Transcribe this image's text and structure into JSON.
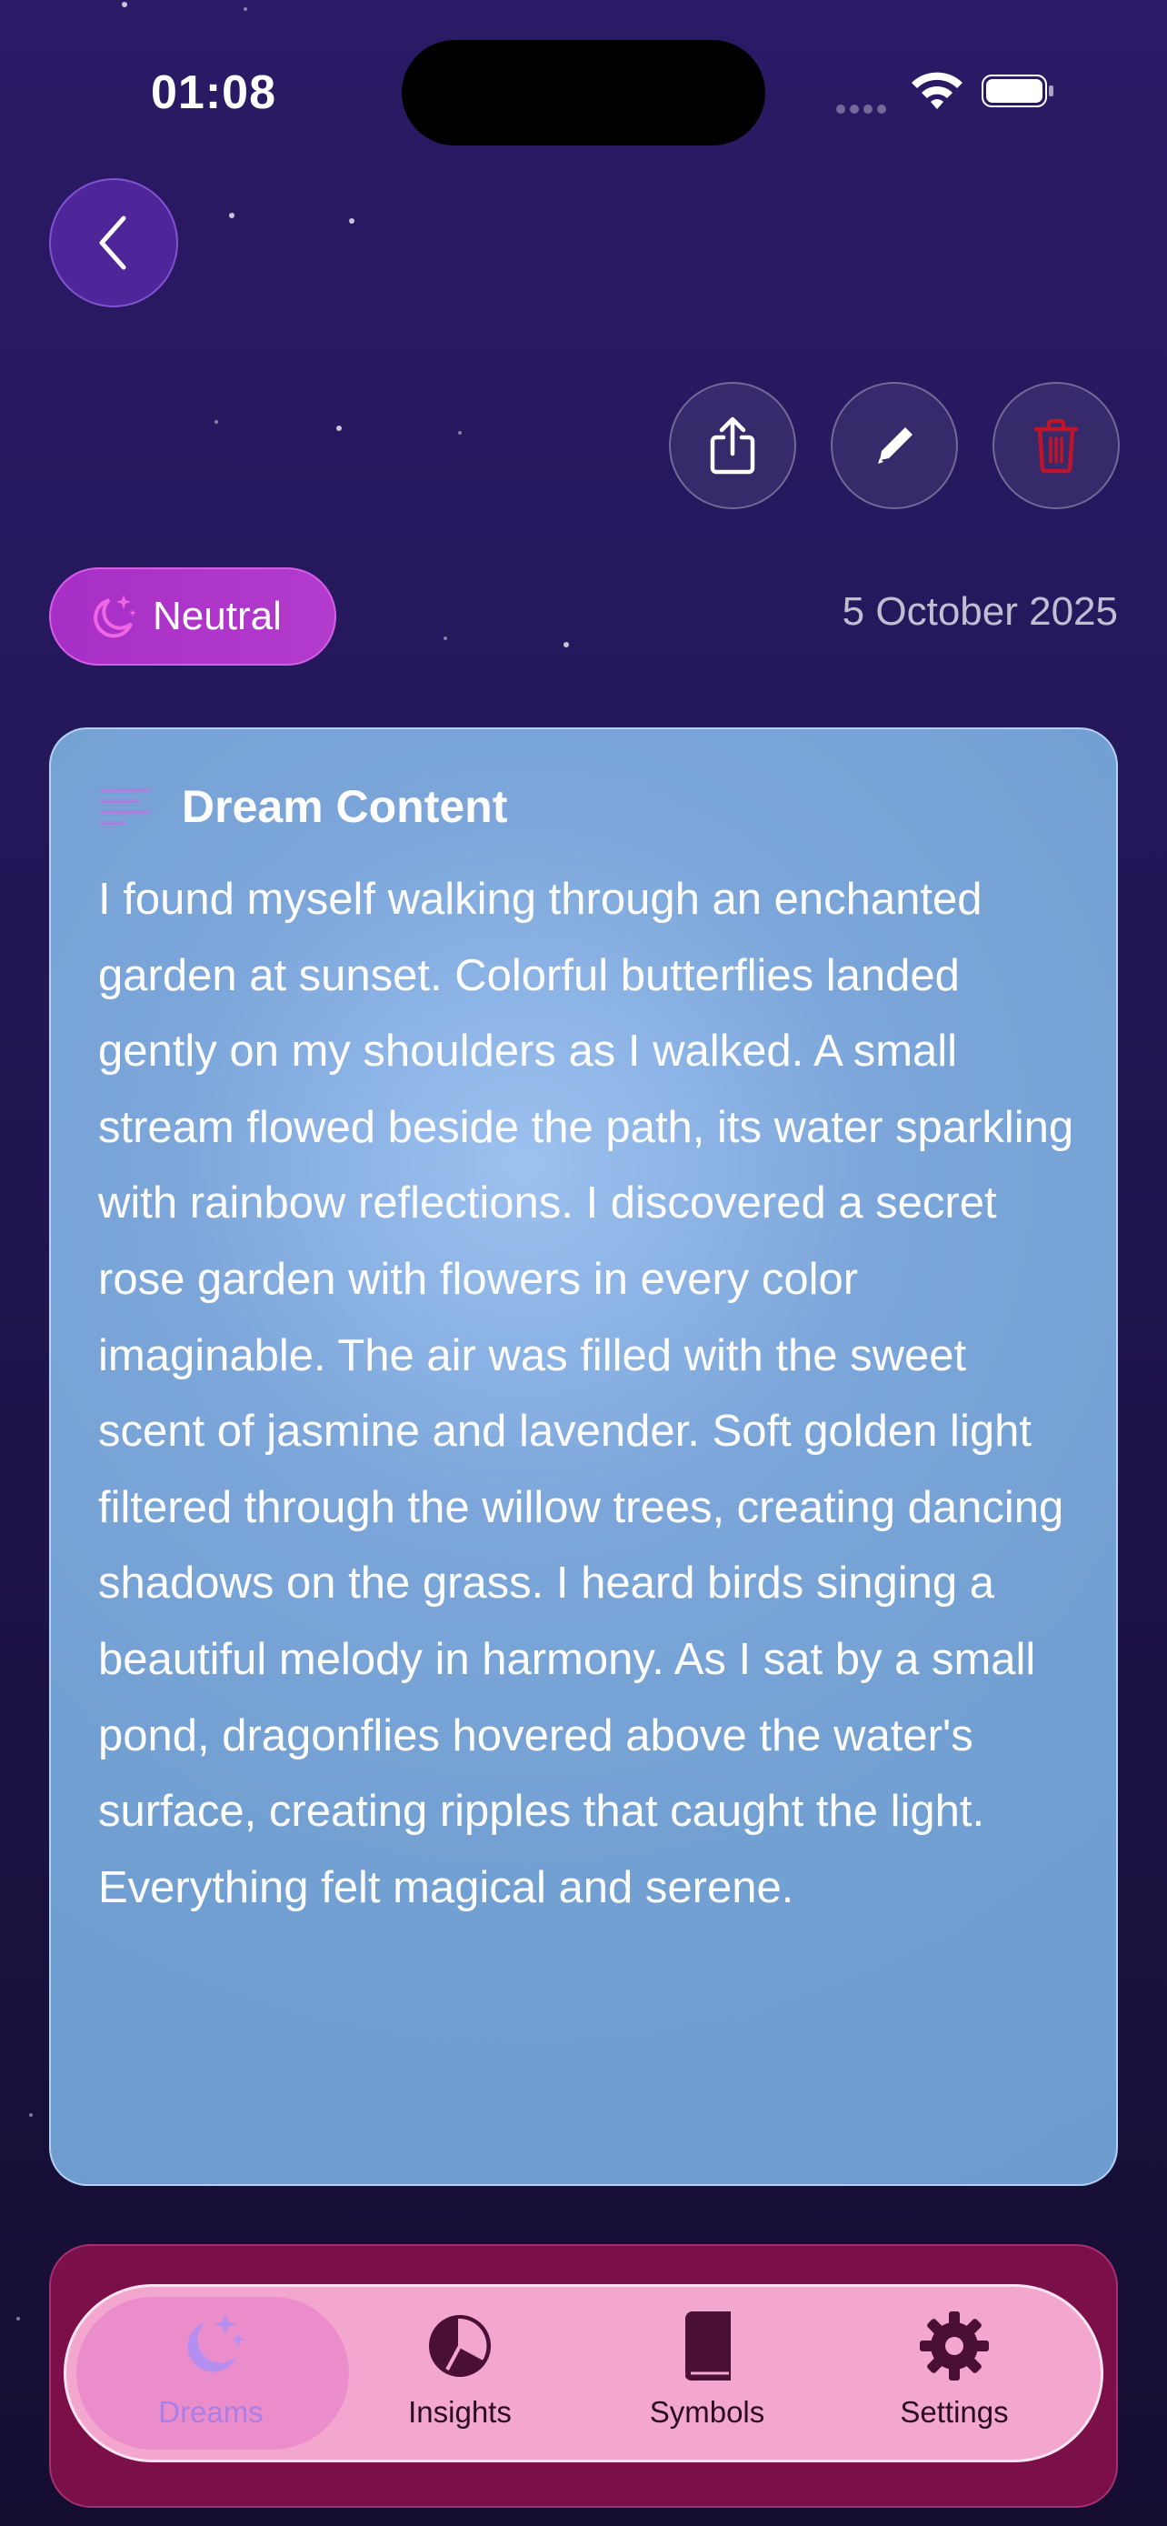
{
  "status_bar": {
    "time": "01:08"
  },
  "header": {
    "back_icon": "chevron-left-icon",
    "actions": [
      {
        "name": "share",
        "icon": "share-icon"
      },
      {
        "name": "edit",
        "icon": "pencil-icon"
      },
      {
        "name": "delete",
        "icon": "trash-icon"
      }
    ]
  },
  "dream": {
    "mood": "Neutral",
    "mood_icon": "moon-sparkles-icon",
    "date": "5 October 2025",
    "content_title": "Dream Content",
    "content": "I found myself walking through an enchanted garden at sunset. Colorful butterflies landed gently on my shoulders as I walked. A small stream flowed beside the path, its water sparkling with rainbow reflections. I discovered a secret rose garden with flowers in every color imaginable. The air was filled with the sweet scent of jasmine and lavender. Soft golden light filtered through the willow trees, creating dancing shadows on the grass. I heard birds singing a beautiful melody in harmony. As I sat by a small pond, dragonflies hovered above the water's surface, creating ripples that caught the light. Everything felt magical and serene."
  },
  "tabs": [
    {
      "label": "Dreams",
      "icon": "moon-stars-icon",
      "active": true
    },
    {
      "label": "Insights",
      "icon": "pie-chart-icon",
      "active": false
    },
    {
      "label": "Symbols",
      "icon": "book-icon",
      "active": false
    },
    {
      "label": "Settings",
      "icon": "gear-icon",
      "active": false
    }
  ],
  "colors": {
    "background": "#24175a",
    "mood_pill": "#b23bcc",
    "card": "#7ca6da",
    "tab_bar": "#7a0f4a",
    "tab_inner": "#f3a7cf",
    "delete": "#c0142b"
  }
}
